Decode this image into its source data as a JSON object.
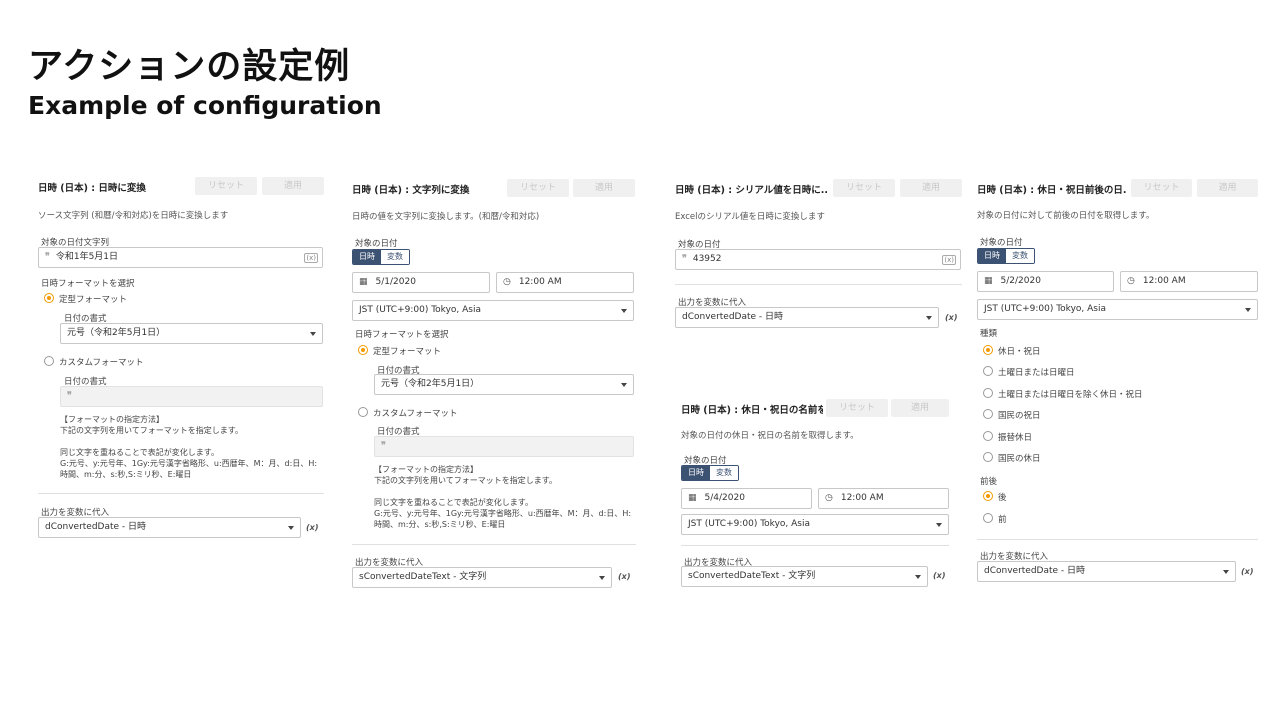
{
  "slide": {
    "title": "アクションの設定例",
    "subtitle": "Example of configuration"
  },
  "common": {
    "reset": "リセット",
    "apply": "適用",
    "tab_date": "日時",
    "tab_var": "変数",
    "std_format": "定型フォーマット",
    "custom_format": "カスタムフォーマット",
    "date_format_label": "日付の書式",
    "format_select_label": "日時フォーマットを選択",
    "target_date_label": "対象の日付",
    "output_label": "出力を変数に代入",
    "help_text": "【フォーマットの指定方法】\n下記の文字列を用いてフォーマットを指定します。\n\n同じ文字を重ねることで表記が変化します。\nG:元号、y:元号年、1Gy:元号漢字省略形、u:西暦年、M：月、d:日、H:\n時間、m:分、s:秒,S:ミリ秒、E:曜日"
  },
  "panel1": {
    "title": "日時 (日本) : 日時に変換",
    "description": "ソース文字列 (和暦/令和対応)を日時に変換します",
    "source_label": "対象の日付文字列",
    "source_value": "令和1年5月1日",
    "format_value": "元号（令和2年5月1日）",
    "output_value": "dConvertedDate - 日時"
  },
  "panel2": {
    "title": "日時 (日本) : 文字列に変換",
    "description": "日時の値を文字列に変換します。(和暦/令和対応)",
    "date_value": "5/1/2020",
    "time_value": "12:00 AM",
    "timezone": "JST (UTC+9:00) Tokyo, Asia",
    "format_value": "元号（令和2年5月1日）",
    "output_value": "sConvertedDateText - 文字列"
  },
  "panel3": {
    "title": "日時 (日本) : シリアル値を日時に...",
    "description": "Excelのシリアル値を日時に変換します",
    "serial_value": "43952",
    "output_value": "dConvertedDate - 日時"
  },
  "panel4": {
    "title": "日時 (日本) : 休日・祝日前後の日...",
    "description": "対象の日付に対して前後の日付を取得します。",
    "date_value": "5/2/2020",
    "time_value": "12:00 AM",
    "timezone": "JST (UTC+9:00) Tokyo, Asia",
    "type_label": "種類",
    "types": [
      "休日・祝日",
      "土曜日または日曜日",
      "土曜日または日曜日を除く休日・祝日",
      "国民の祝日",
      "振替休日",
      "国民の休日"
    ],
    "direction_label": "前後",
    "directions": [
      "後",
      "前"
    ],
    "output_value": "dConvertedDate - 日時"
  },
  "panel5": {
    "title": "日時 (日本) : 休日・祝日の名前を...",
    "description": "対象の日付の休日・祝日の名前を取得します。",
    "date_value": "5/4/2020",
    "time_value": "12:00 AM",
    "timezone": "JST (UTC+9:00) Tokyo, Asia",
    "output_value": "sConvertedDateText - 文字列"
  }
}
